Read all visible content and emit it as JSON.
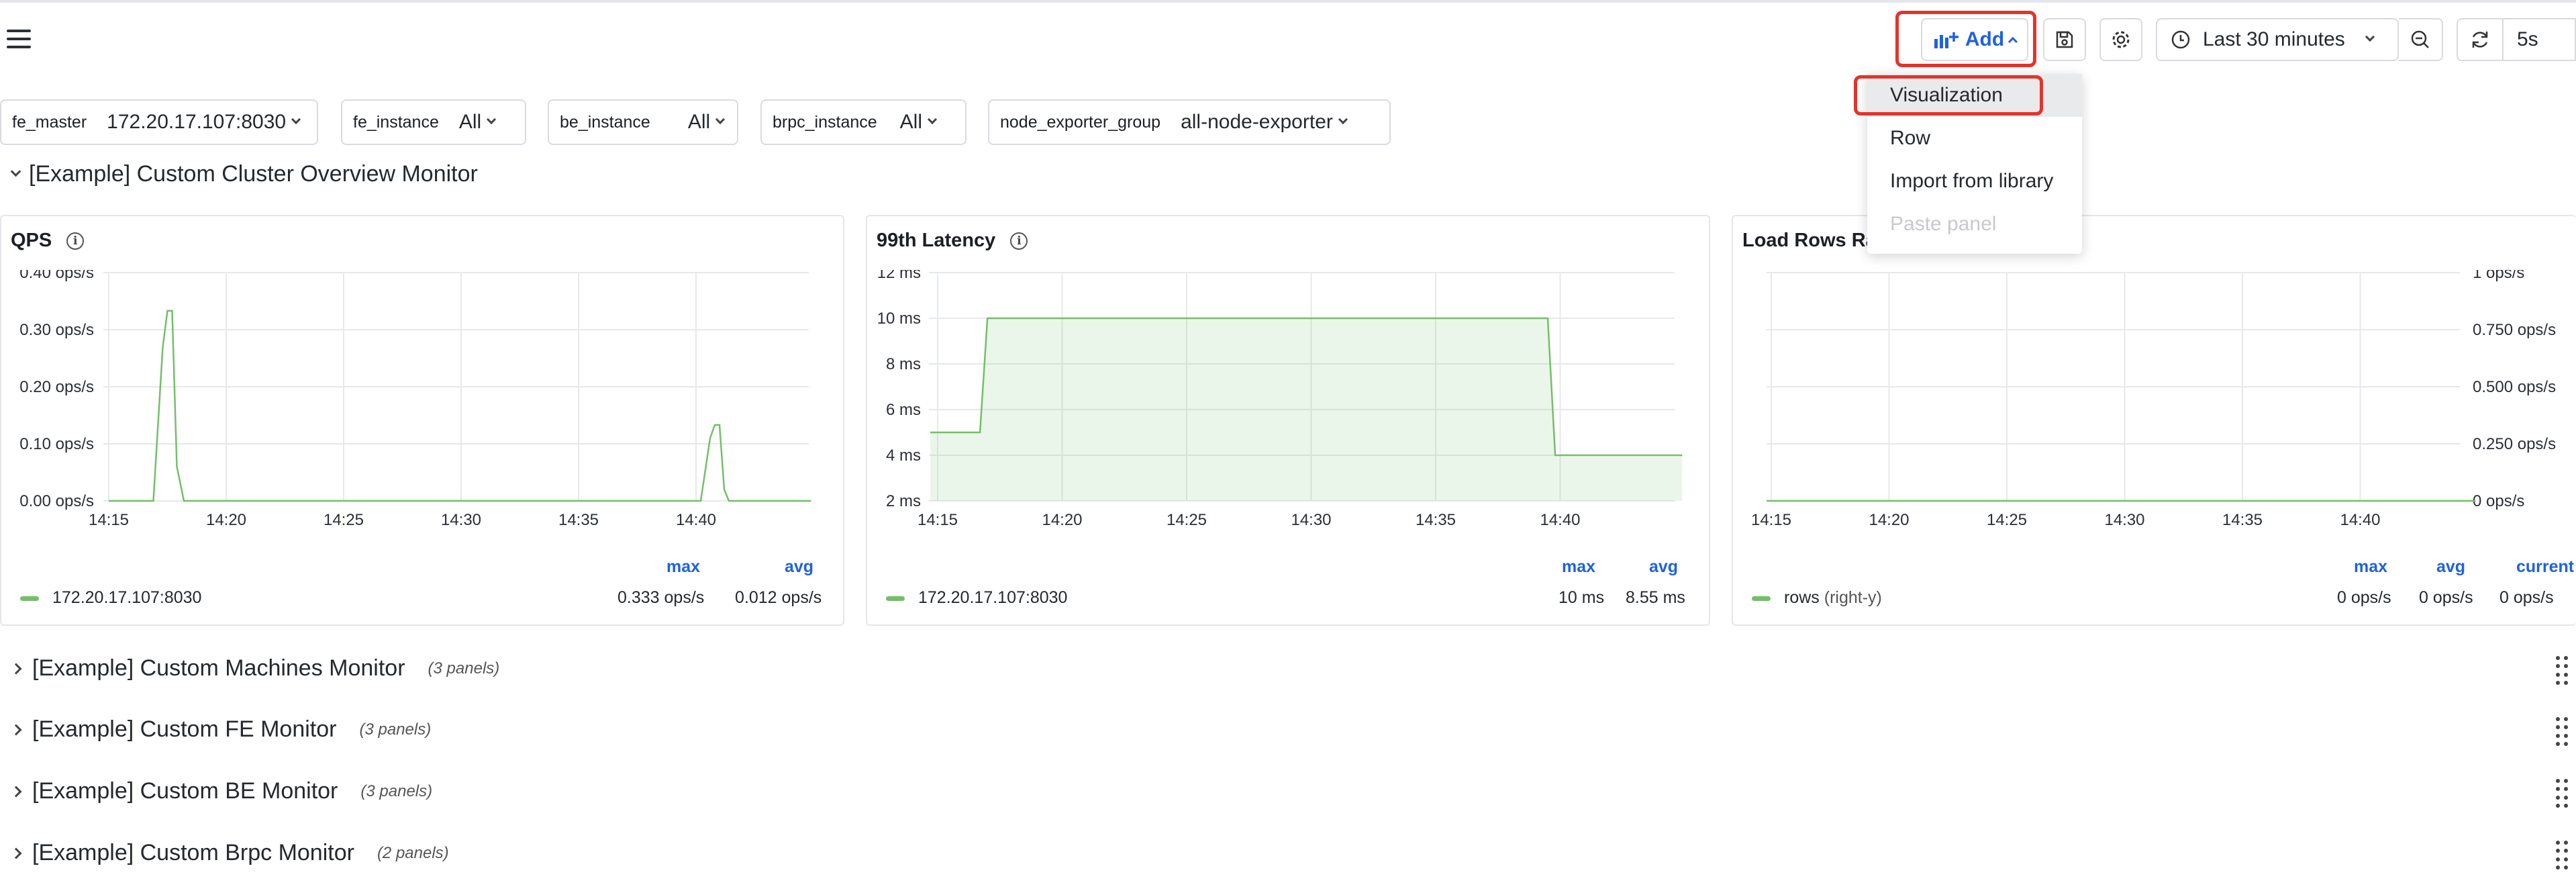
{
  "toolbar": {
    "add_label": "Add",
    "time_range": "Last 30 minutes",
    "refresh_interval": "5s"
  },
  "add_menu": {
    "items": [
      {
        "label": "Visualization",
        "state": "highlighted"
      },
      {
        "label": "Row",
        "state": "normal"
      },
      {
        "label": "Import from library",
        "state": "normal"
      },
      {
        "label": "Paste panel",
        "state": "disabled"
      }
    ]
  },
  "variables": [
    {
      "label": "fe_master",
      "value": "172.20.17.107:8030"
    },
    {
      "label": "fe_instance",
      "value": "All"
    },
    {
      "label": "be_instance",
      "value": "All"
    },
    {
      "label": "brpc_instance",
      "value": "All"
    },
    {
      "label": "node_exporter_group",
      "value": "all-node-exporter"
    }
  ],
  "rows": [
    {
      "title": "[Example] Custom Cluster Overview Monitor",
      "expanded": true,
      "count": ""
    },
    {
      "title": "[Example] Custom Machines Monitor",
      "expanded": false,
      "count": "(3 panels)"
    },
    {
      "title": "[Example] Custom FE Monitor",
      "expanded": false,
      "count": "(3 panels)"
    },
    {
      "title": "[Example] Custom BE Monitor",
      "expanded": false,
      "count": "(3 panels)"
    },
    {
      "title": "[Example] Custom Brpc Monitor",
      "expanded": false,
      "count": "(2 panels)"
    }
  ],
  "panels": [
    {
      "title": "QPS",
      "legend_name": "172.20.17.107:8030",
      "legend_headers": [
        "max",
        "avg"
      ],
      "legend_values": [
        "0.333 ops/s",
        "0.012 ops/s"
      ]
    },
    {
      "title": "99th Latency",
      "legend_name": "172.20.17.107:8030",
      "legend_headers": [
        "max",
        "avg"
      ],
      "legend_values": [
        "10 ms",
        "8.55 ms"
      ]
    },
    {
      "title": "Load Rows Ra",
      "legend_name": "rows",
      "legend_suffix": "(right-y)",
      "legend_headers": [
        "max",
        "avg",
        "current"
      ],
      "legend_values": [
        "0 ops/s",
        "0 ops/s",
        "0 ops/s"
      ]
    }
  ],
  "chart_data": [
    {
      "type": "line",
      "title": "QPS",
      "x_ticks": [
        "14:15",
        "14:20",
        "14:25",
        "14:30",
        "14:35",
        "14:40"
      ],
      "y_ticks": [
        "0.00 ops/s",
        "0.10 ops/s",
        "0.20 ops/s",
        "0.30 ops/s",
        "0.40 ops/s"
      ],
      "ylim": [
        0,
        0.4
      ],
      "xlim_minutes": [
        0,
        30
      ],
      "series": [
        {
          "name": "172.20.17.107:8030",
          "color": "#73bf69",
          "x_minutes": [
            0,
            1.9,
            2.3,
            2.5,
            2.7,
            2.9,
            3.2,
            3.4,
            25.2,
            25.6,
            25.8,
            26.0,
            26.2,
            26.4,
            26.6,
            29.9
          ],
          "values": [
            0,
            0,
            0.27,
            0.333,
            0.333,
            0.06,
            0,
            0,
            0,
            0.11,
            0.133,
            0.133,
            0.02,
            0,
            0,
            0
          ]
        }
      ]
    },
    {
      "type": "area",
      "title": "99th Latency",
      "x_ticks": [
        "14:15",
        "14:20",
        "14:25",
        "14:30",
        "14:35",
        "14:40"
      ],
      "y_ticks": [
        "2 ms",
        "4 ms",
        "6 ms",
        "8 ms",
        "10 ms",
        "12 ms"
      ],
      "ylim": [
        2,
        12
      ],
      "xlim_minutes": [
        0,
        30
      ],
      "series": [
        {
          "name": "172.20.17.107:8030",
          "color": "#73bf69",
          "x_minutes": [
            -0.3,
            1.7,
            2.0,
            24.5,
            24.8,
            29.9
          ],
          "values": [
            5,
            5,
            10,
            10,
            4,
            4
          ]
        }
      ]
    },
    {
      "type": "line",
      "title": "Load Rows Ra",
      "x_ticks": [
        "14:15",
        "14:20",
        "14:25",
        "14:30",
        "14:35",
        "14:40"
      ],
      "y_ticks": [
        "0 ops/s",
        "0.250 ops/s",
        "0.500 ops/s",
        "0.750 ops/s",
        "1 ops/s"
      ],
      "ylim": [
        0,
        1
      ],
      "xlim_minutes": [
        0,
        30
      ],
      "series": [
        {
          "name": "rows",
          "color": "#73bf69",
          "x_minutes": [
            -0.2,
            29.9
          ],
          "values": [
            0,
            0
          ]
        }
      ]
    }
  ]
}
